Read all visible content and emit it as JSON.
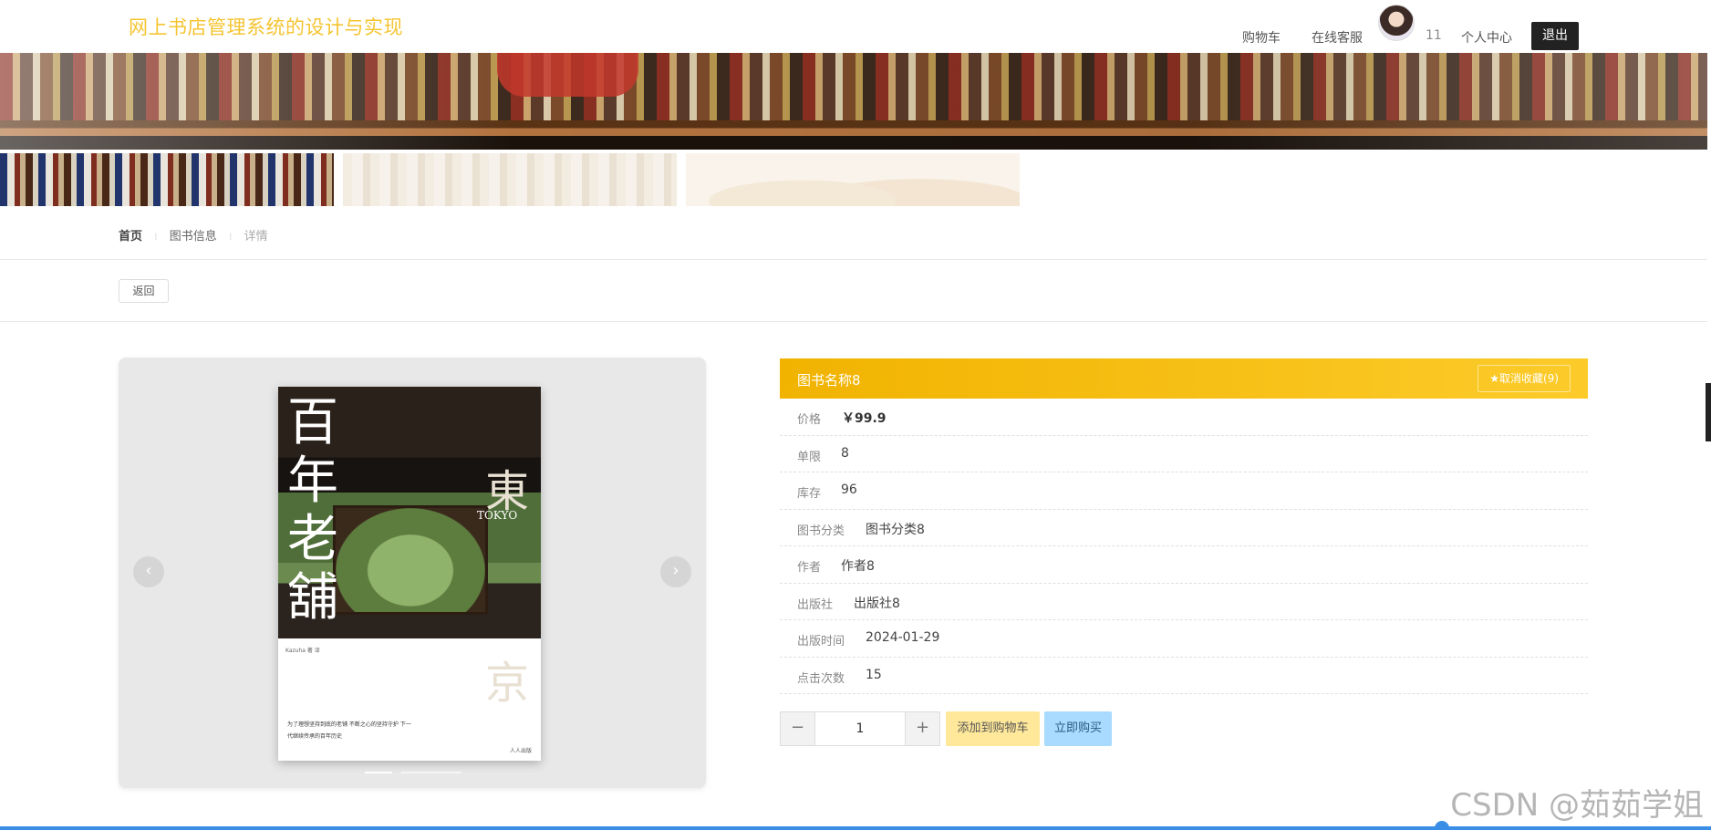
{
  "header": {
    "site_title": "网上书店管理系统的设计与实现",
    "nav": {
      "cart": "购物车",
      "service": "在线客服",
      "user_count": "11",
      "profile": "个人中心",
      "logout": "退出"
    }
  },
  "breadcrumb": {
    "home": "首页",
    "list": "图书信息",
    "current": "详情"
  },
  "back_label": "返回",
  "cover": {
    "title_left": "百年老舖",
    "title_right": "東京",
    "subtitle": "TOKYO",
    "author_line": "Kazuha 著 译",
    "blurb": "为了理想坚持到底的老铺 不断之心的坚持守护 下一代继续传承的百年历史",
    "publisher": "人人出版",
    "prev_icon": "‹",
    "next_icon": "›"
  },
  "book": {
    "name": "图书名称8",
    "favorite_label": "★取消收藏(9)",
    "fields": [
      {
        "label": "价格",
        "value": "￥99.9"
      },
      {
        "label": "单限",
        "value": "8"
      },
      {
        "label": "库存",
        "value": "96"
      },
      {
        "label": "图书分类",
        "value": "图书分类8"
      },
      {
        "label": "作者",
        "value": "作者8"
      },
      {
        "label": "出版社",
        "value": "出版社8"
      },
      {
        "label": "出版时间",
        "value": "2024-01-29"
      },
      {
        "label": "点击次数",
        "value": "15"
      }
    ]
  },
  "purchase": {
    "minus": "−",
    "plus": "+",
    "quantity": "1",
    "add_to_cart": "添加到购物车",
    "buy_now": "立即购买"
  },
  "watermark": "CSDN @茹茹学姐",
  "colors": {
    "title_accent": "#f5c431",
    "header_gradient_start": "#f1b300",
    "header_gradient_end": "#fccb2a",
    "add_cart_bg": "#ffe89a",
    "buy_now_bg": "#a8dbff"
  }
}
